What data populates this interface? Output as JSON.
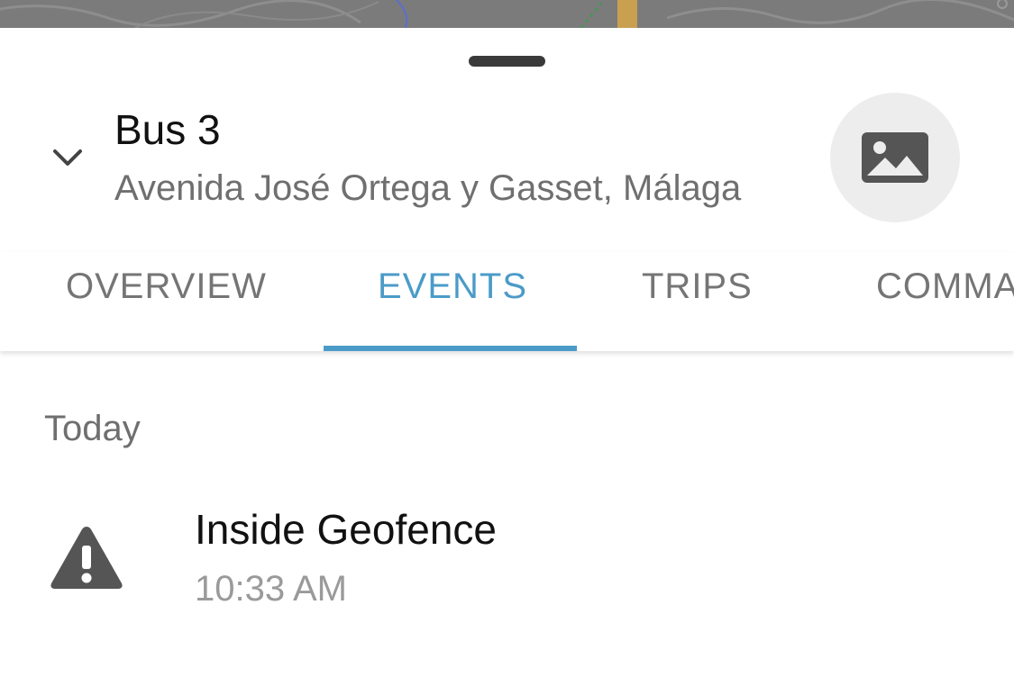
{
  "device": {
    "name": "Bus 3",
    "address": "Avenida José Ortega y Gasset, Málaga"
  },
  "tabs": [
    {
      "label": "OVERVIEW",
      "active": false
    },
    {
      "label": "EVENTS",
      "active": true
    },
    {
      "label": "TRIPS",
      "active": false
    },
    {
      "label": "COMMANDS",
      "active": false
    }
  ],
  "events": {
    "section_label": "Today",
    "items": [
      {
        "title": "Inside Geofence",
        "time": "10:33 AM",
        "icon": "warning-icon"
      }
    ]
  },
  "icons": {
    "collapse": "chevron-down-icon",
    "avatar": "image-placeholder-icon"
  },
  "colors": {
    "accent": "#4b9bc8",
    "map_background": "#7b7b7b"
  }
}
